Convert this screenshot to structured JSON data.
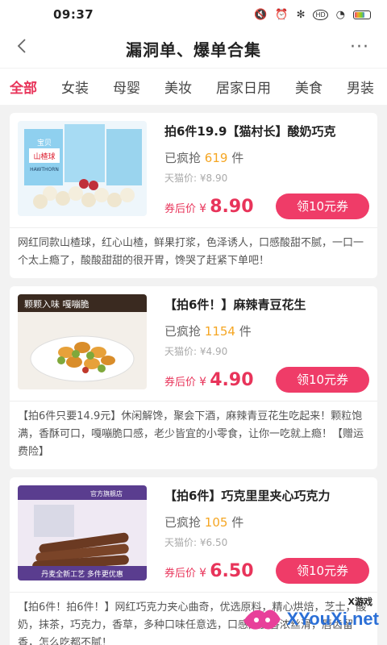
{
  "status": {
    "time": "09:37"
  },
  "nav": {
    "title": "漏洞单、爆单合集",
    "back_icon": "chevron-left-icon",
    "more_icon": "more-dots-icon"
  },
  "tabs": [
    "全部",
    "女装",
    "母婴",
    "美妆",
    "居家日用",
    "美食",
    "男装"
  ],
  "active_tab": 0,
  "products": [
    {
      "title": "拍6件19.9【猫村长】酸奶巧克",
      "sold_prefix": "已疯抢",
      "sold": "619",
      "sold_suffix": "件",
      "tmall_price": "天猫价: ¥8.90",
      "price_label": "券后价",
      "price_symbol": "¥",
      "price": "8.90",
      "coupon": "领10元券",
      "desc": "网红同款山楂球，红心山楂，鲜果打浆，色泽诱人，口感酸甜不腻，一口一个太上瘾了，酸酸甜甜的很开胃，馋哭了赶紧下单吧！",
      "image_text": [
        "宝贝",
        "山楂球",
        "HAWTHORN"
      ]
    },
    {
      "title": "【拍6件！】麻辣青豆花生",
      "sold_prefix": "已疯抢",
      "sold": "1154",
      "sold_suffix": "件",
      "tmall_price": "天猫价: ¥4.90",
      "price_label": "券后价",
      "price_symbol": "¥",
      "price": "4.90",
      "coupon": "领10元券",
      "desc": "【拍6件只要14.9元】休闲解馋，聚会下酒，麻辣青豆花生吃起来！颗粒饱满，香酥可口，嘎嘣脆口感，老少皆宜的小零食，让你一吃就上瘾！【赠运费险】",
      "image_text": [
        "颗颗入味 嘎嘣脆"
      ]
    },
    {
      "title": "【拍6件】巧克里里夹心巧克力",
      "sold_prefix": "已疯抢",
      "sold": "105",
      "sold_suffix": "件",
      "tmall_price": "天猫价: ¥6.50",
      "price_label": "券后价",
      "price_symbol": "¥",
      "price": "6.50",
      "coupon": "领10元券",
      "desc": "【拍6件！拍6件！】网红巧克力夹心曲奇，优选原料，精心烘焙，芝士，酸奶，抹茶，巧克力，香草，多种口味任意选，口感酥脆香浓丝滑，唇齿留香，怎么吃都不腻！",
      "image_text": [
        "官方旗舰店",
        "丹麦全新工艺 多件更优惠"
      ]
    }
  ],
  "watermark": {
    "small": "X游戏",
    "text": "XYouXi.net"
  }
}
